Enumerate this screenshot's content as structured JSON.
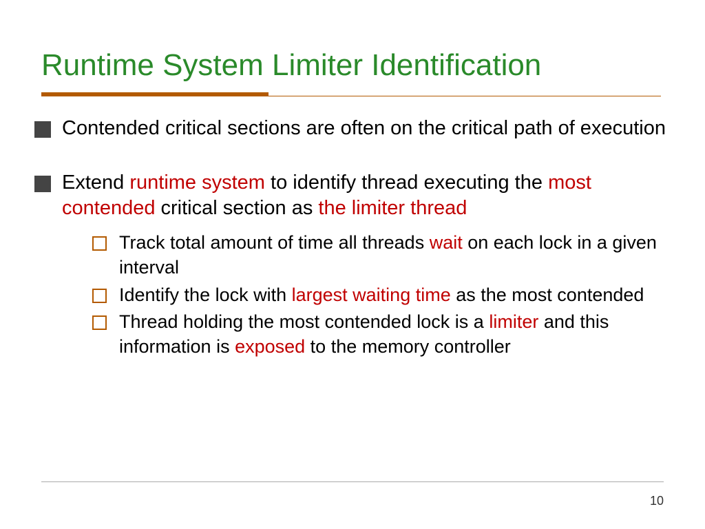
{
  "title": "Runtime System Limiter Identification",
  "b1": {
    "text": "Contended critical sections are often on the critical path of execution"
  },
  "b2": {
    "pre": "Extend ",
    "em1": "runtime system",
    "mid1": " to identify thread executing the ",
    "em2": "most contended",
    "mid2": " critical section as ",
    "em3": "the limiter thread"
  },
  "s1": {
    "pre": "Track total amount of time all threads ",
    "em1": "wait",
    "post": " on each lock in a given interval"
  },
  "s2": {
    "pre": "Identify the lock with ",
    "em1": "largest waiting time",
    "post": " as the most contended"
  },
  "s3": {
    "pre": "Thread holding the most contended lock is a ",
    "em1": "limiter",
    "mid": " and this information is ",
    "em2": "exposed",
    "post": " to the memory controller"
  },
  "page": "10"
}
